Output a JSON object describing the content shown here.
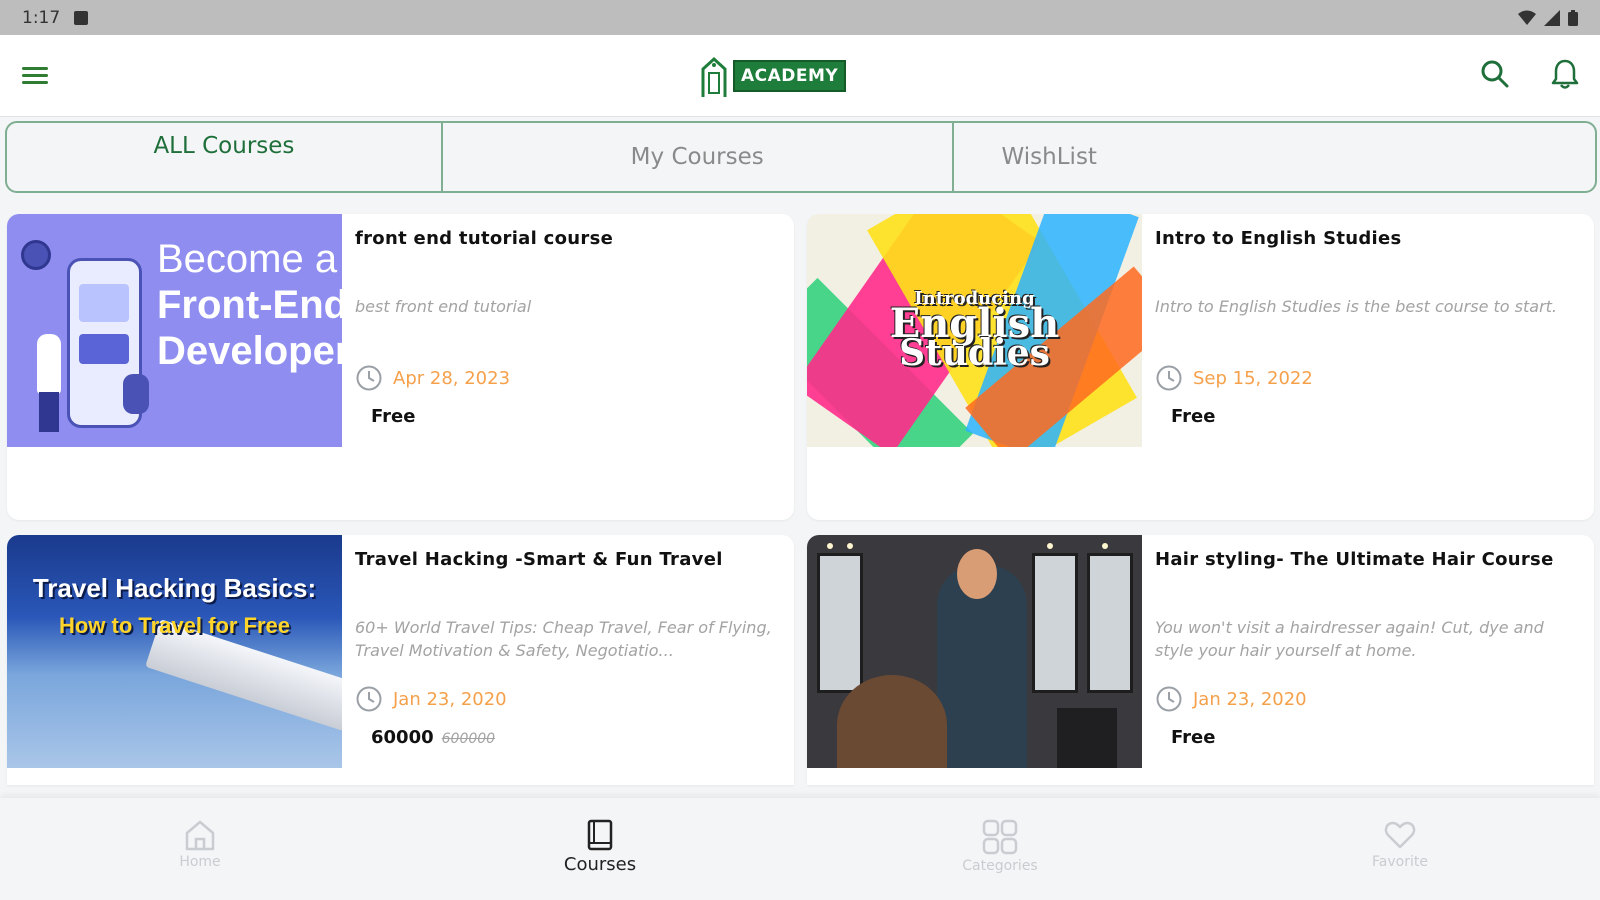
{
  "status_bar": {
    "time": "1:17"
  },
  "app_bar": {
    "logo_text": "ACADEMY"
  },
  "tabs": [
    {
      "label": "ALL Courses",
      "active": true
    },
    {
      "label": "My Courses",
      "active": false
    },
    {
      "label": "WishList",
      "active": false
    }
  ],
  "courses": [
    {
      "title": "front end tutorial course",
      "description": "best front end tutorial",
      "date": "Apr 28, 2023",
      "price": "Free",
      "old_price": "",
      "thumb_lines": [
        "Become a",
        "Front-End",
        "Developer"
      ]
    },
    {
      "title": "Intro to English Studies",
      "description": "Intro to English Studies is the best course to start.",
      "date": "Sep 15, 2022",
      "price": "Free",
      "old_price": "",
      "thumb_lines": [
        "Introducing",
        "English",
        "Studies"
      ]
    },
    {
      "title": "Travel Hacking -Smart & Fun Travel",
      "description": "60+ World Travel Tips: Cheap Travel, Fear of Flying, Travel Motivation & Safety, Negotiatio...",
      "date": "Jan 23, 2020",
      "price": "60000",
      "old_price": "600000",
      "thumb_lines": [
        "Travel Hacking Basics:",
        "How to Travel for Free"
      ]
    },
    {
      "title": "Hair styling- The Ultimate Hair Course",
      "description": "You won't visit a hairdresser again! Cut, dye and style your hair yourself at home.",
      "date": "Jan 23, 2020",
      "price": "Free",
      "old_price": "",
      "thumb_lines": []
    }
  ],
  "bottom_nav": [
    {
      "label": "Home",
      "icon": "home-icon",
      "active": false
    },
    {
      "label": "Courses",
      "icon": "book-icon",
      "active": true
    },
    {
      "label": "Categories",
      "icon": "grid-icon",
      "active": false
    },
    {
      "label": "Favorite",
      "icon": "heart-icon",
      "active": false
    }
  ],
  "colors": {
    "accent_green": "#1f6f3a",
    "tab_border": "#7fae92",
    "date_orange": "#f5a04a",
    "muted_text": "#a3a3a3"
  }
}
